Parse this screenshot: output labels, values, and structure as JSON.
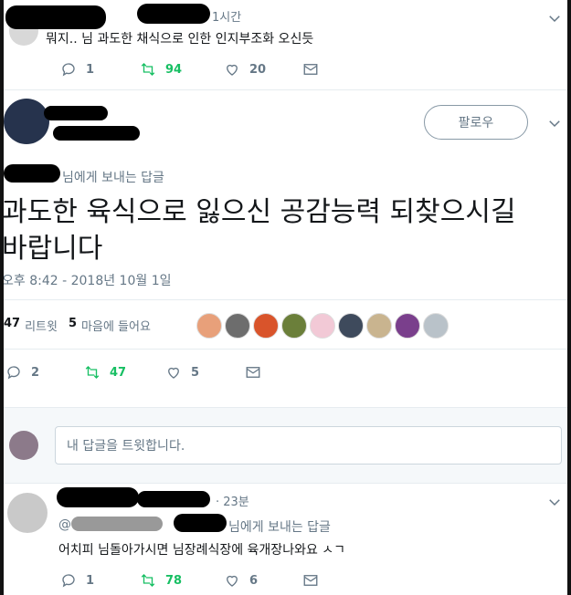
{
  "top_tweet": {
    "time": "1시간",
    "text": "뭐지.. 님 과도한 채식으로 인한 인지부조화 오신듯",
    "reply_count": "1",
    "retweet_count": "94",
    "like_count": "20"
  },
  "main_tweet": {
    "follow_label": "팔로우",
    "reply_to_label": "님에게 보내는 답글",
    "text_line1": "과도한 육식으로 잃으신 공감능력 되찾으시길",
    "text_line2": "바랍니다",
    "timestamp": "오후 8:42 - 2018년 10월 1일",
    "stats": {
      "retweet_count": "47",
      "retweet_label": "리트윗",
      "like_count": "5",
      "like_label": "마음에 들어요"
    },
    "actions": {
      "reply_count": "2",
      "retweet_count": "47",
      "like_count": "5"
    },
    "liker_colors": [
      "#e8a07a",
      "#6d6d6d",
      "#d9542b",
      "#6b7f3a",
      "#f2c9d6",
      "#3e4a5c",
      "#c9b48f",
      "#7a3f8c",
      "#b9c2c9"
    ]
  },
  "reply_box": {
    "placeholder": "내 답글을 트윗합니다."
  },
  "reply_tweet": {
    "time": "23분",
    "reply_to_prefix": "@",
    "reply_to_label": "님에게 보내는 답글",
    "text": "어치피 님돌아가시면 님장례식장에 육개장나와요 ㅅㄱ",
    "reply_count": "1",
    "retweet_count": "78",
    "like_count": "6"
  },
  "colors": {
    "retweet_green": "#17bf63",
    "muted_gray": "#657786"
  }
}
